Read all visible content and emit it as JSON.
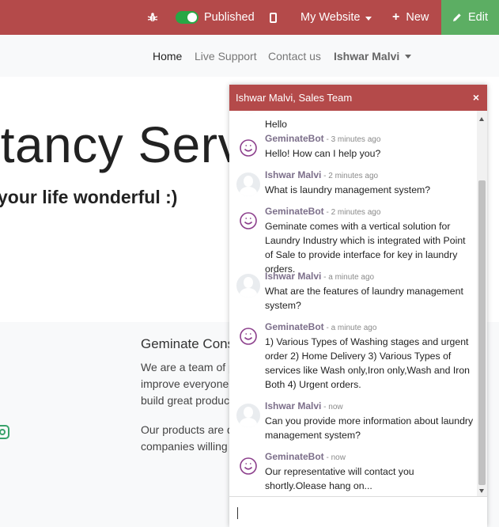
{
  "topbar": {
    "bug_icon": "bug-icon",
    "published_label": "Published",
    "mobile_icon": "mobile-icon",
    "website_label": "My Website",
    "new_label": "New",
    "edit_label": "Edit",
    "bar_color": "#b44a4a",
    "edit_color": "#5cae63",
    "toggle_color": "#28a745"
  },
  "nav": {
    "home": "Home",
    "support": "Live Support",
    "contact": "Contact us",
    "user": "Ishwar Malvi"
  },
  "hero": {
    "title": "ltancy Serv",
    "subtitle": "your life wonderful :)"
  },
  "footer": {
    "company_title": "Geminate Cons",
    "about_lines": [
      "We are a team of p",
      "improve everyone'",
      "build great produc"
    ],
    "products_lines": [
      "Our products are d",
      "companies willing"
    ],
    "social_icon": "instagram-icon"
  },
  "chat": {
    "header": "Ishwar Malvi, Sales Team",
    "close_glyph": "×",
    "accent": "#b44a4a",
    "partial_message": "Hello",
    "messages": [
      {
        "author": "GeminateBot",
        "time": "3 minutes ago",
        "avatar": "bot",
        "text": "Hello! How can I help you?"
      },
      {
        "author": "Ishwar Malvi",
        "time": "2 minutes ago",
        "avatar": "user",
        "text": "What is laundry management system?"
      },
      {
        "author": "GeminateBot",
        "time": "2 minutes ago",
        "avatar": "bot",
        "text": "Geminate comes with a vertical solution for Laundry Industry which is integrated with Point of Sale to provide interface for key in laundry orders."
      },
      {
        "author": "Ishwar Malvi",
        "time": "a minute ago",
        "avatar": "user",
        "text": "What are the features of laundry management system?"
      },
      {
        "author": "GeminateBot",
        "time": "a minute ago",
        "avatar": "bot",
        "text": "1) Various Types of Washing stages and urgent order 2) Home Delivery 3) Various Types of services like Wash only,Iron only,Wash and Iron Both 4) Urgent orders."
      },
      {
        "author": "Ishwar Malvi",
        "time": "now",
        "avatar": "user",
        "text": "Can you provide more information about laundry management system?"
      },
      {
        "author": "GeminateBot",
        "time": "now",
        "avatar": "bot",
        "text": "Our representative will contact you shortly.Olease hang on..."
      }
    ],
    "composer_value": ""
  }
}
